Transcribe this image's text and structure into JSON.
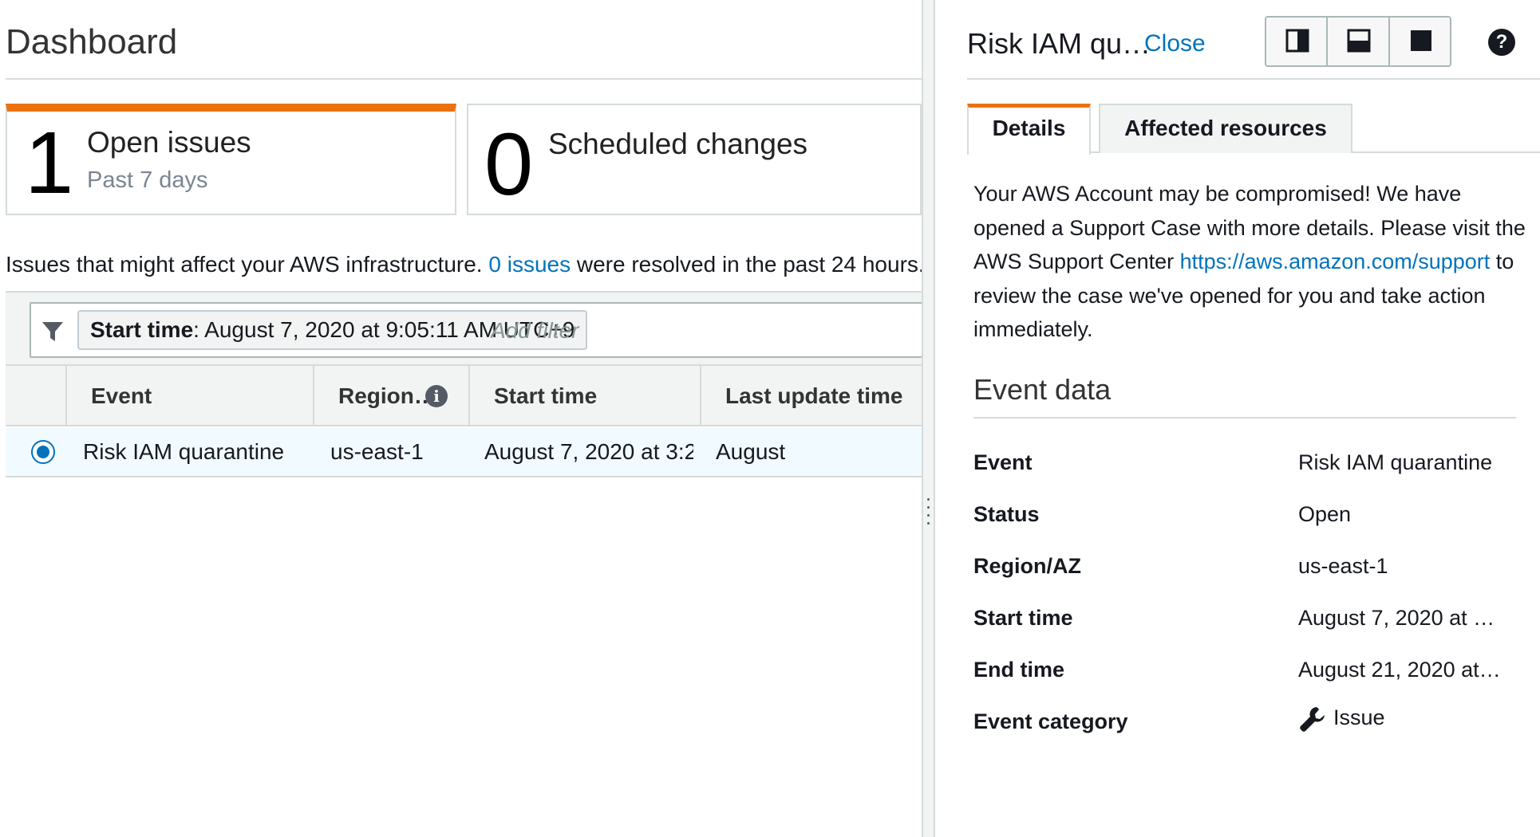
{
  "dashboard": {
    "title": "Dashboard",
    "open_issues": {
      "count": "1",
      "label": "Open issues",
      "sublabel": "Past 7 days"
    },
    "scheduled_changes": {
      "count": "0",
      "label": "Scheduled changes"
    },
    "issues_text_before": "Issues that might affect your AWS infrastructure. ",
    "issues_link": "0 issues",
    "issues_text_after": " were resolved in the past 24 hours.",
    "filter": {
      "token_key": "Start time",
      "token_value": ": August 7, 2020 at 9:05:11 AM UTC+9",
      "placeholder": "Add filter"
    },
    "table": {
      "columns": [
        "Event",
        "Region…",
        "Start time",
        "Last update time"
      ],
      "rows": [
        {
          "event": "Risk IAM quarantine",
          "region": "us-east-1",
          "start_time": "August 7, 2020 at 3:2…",
          "last": "August"
        }
      ]
    }
  },
  "panel": {
    "title": "Risk IAM qu…",
    "close_label": "Close",
    "tabs": [
      "Details",
      "Affected resources"
    ],
    "description_before": "Your AWS Account may be compromised! We have opened a Support Case with more details. Please visit the AWS Support Center ",
    "description_link": "https://aws.amazon.com/support",
    "description_after": " to review the case we've opened for you and take action immediately.",
    "event_data_title": "Event data",
    "event_data": [
      {
        "label": "Event",
        "value": "Risk IAM quarantine"
      },
      {
        "label": "Status",
        "value": "Open"
      },
      {
        "label": "Region/AZ",
        "value": "us-east-1"
      },
      {
        "label": "Start time",
        "value": "August 7, 2020 at …"
      },
      {
        "label": "End time",
        "value": "August 21, 2020 at…"
      },
      {
        "label": "Event category",
        "value": "Issue"
      }
    ]
  },
  "colors": {
    "accent": "#ec7211",
    "link": "#0073bb",
    "border": "#d5dbdb",
    "row_selected": "#f1faff"
  },
  "icons": [
    "filter-icon",
    "info-icon",
    "help-icon",
    "wrench-icon",
    "split-vertical-icon",
    "split-horizontal-icon",
    "full-screen-icon",
    "drag-handle-icon"
  ]
}
